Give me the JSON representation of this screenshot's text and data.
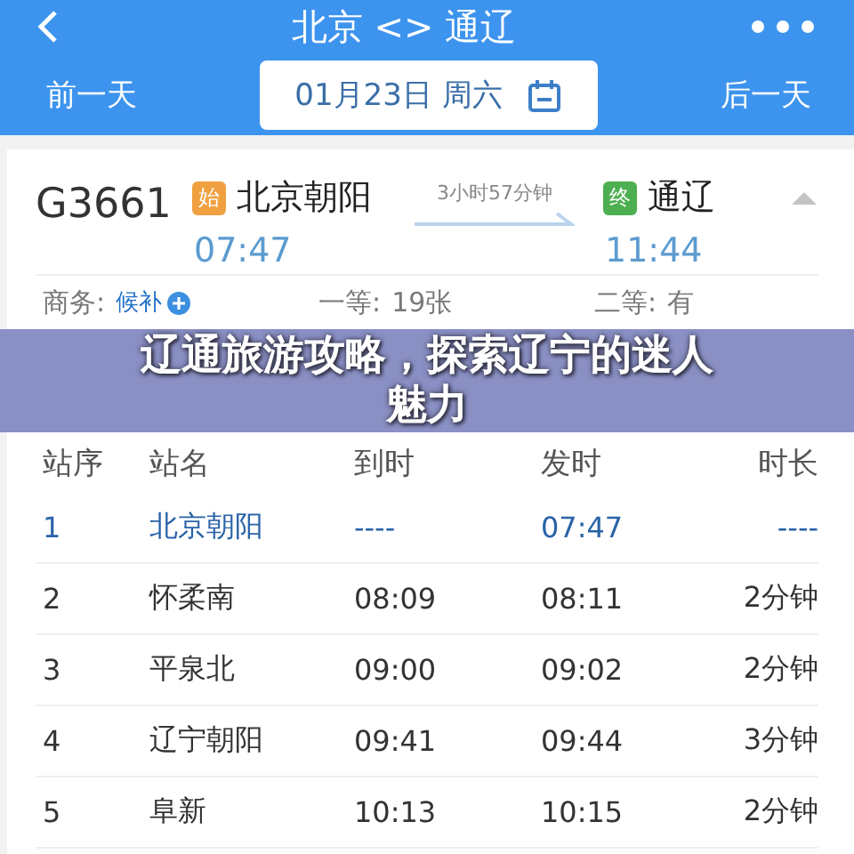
{
  "header": {
    "title": "北京 <> 通辽",
    "prev_day": "前一天",
    "date": "01月23日 周六",
    "next_day": "后一天"
  },
  "train": {
    "number": "G3661",
    "expanded": true,
    "from": {
      "badge": "始",
      "color": "#f0a040",
      "station": "北京朝阳",
      "time": "07:47"
    },
    "duration": "3小时57分钟",
    "to": {
      "badge": "终",
      "color": "#4caf50",
      "station": "通辽",
      "time": "11:44"
    }
  },
  "seats": [
    {
      "kind": "waitlist",
      "label": "商务:",
      "value": "候补"
    },
    {
      "kind": "plain",
      "label": "一等:",
      "value": "19张"
    },
    {
      "kind": "plain",
      "label": "二等:",
      "value": "有"
    }
  ],
  "stops": {
    "columns": [
      "站序",
      "站名",
      "到时",
      "发时",
      "时长"
    ],
    "rows": [
      [
        "1",
        "北京朝阳",
        "----",
        "07:47",
        "----"
      ],
      [
        "2",
        "怀柔南",
        "08:09",
        "08:11",
        "2分钟"
      ],
      [
        "3",
        "平泉北",
        "09:00",
        "09:02",
        "2分钟"
      ],
      [
        "4",
        "辽宁朝阳",
        "09:41",
        "09:44",
        "3分钟"
      ],
      [
        "5",
        "阜新",
        "10:13",
        "10:15",
        "2分钟"
      ]
    ]
  },
  "banner": "辽通旅游攻略，探索辽宁的迷人魅力"
}
